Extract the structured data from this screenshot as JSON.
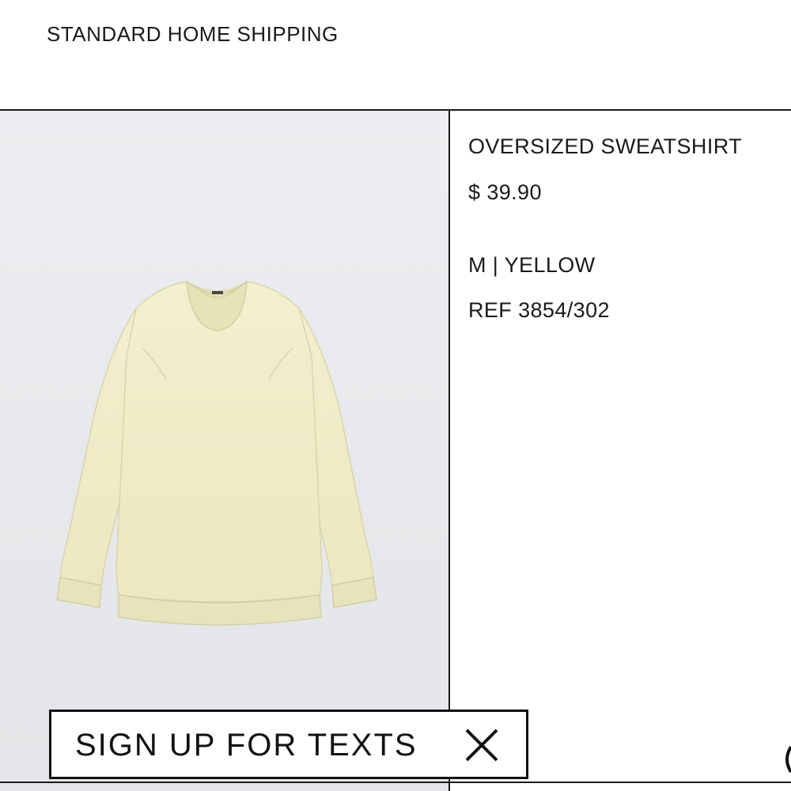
{
  "header": {
    "shipping_label": "STANDARD HOME SHIPPING"
  },
  "product": {
    "image_icon": "sweatshirt-photo",
    "name": "OVERSIZED SWEATSHIRT",
    "price": "$ 39.90",
    "size_color": "M | YELLOW",
    "reference": "REF 3854/302"
  },
  "banner": {
    "label": "SIGN UP FOR TEXTS",
    "close_icon": "close-icon"
  },
  "colors": {
    "garment": "#efedc6",
    "text": "#1a1a1a",
    "background": "#e8eaed"
  }
}
